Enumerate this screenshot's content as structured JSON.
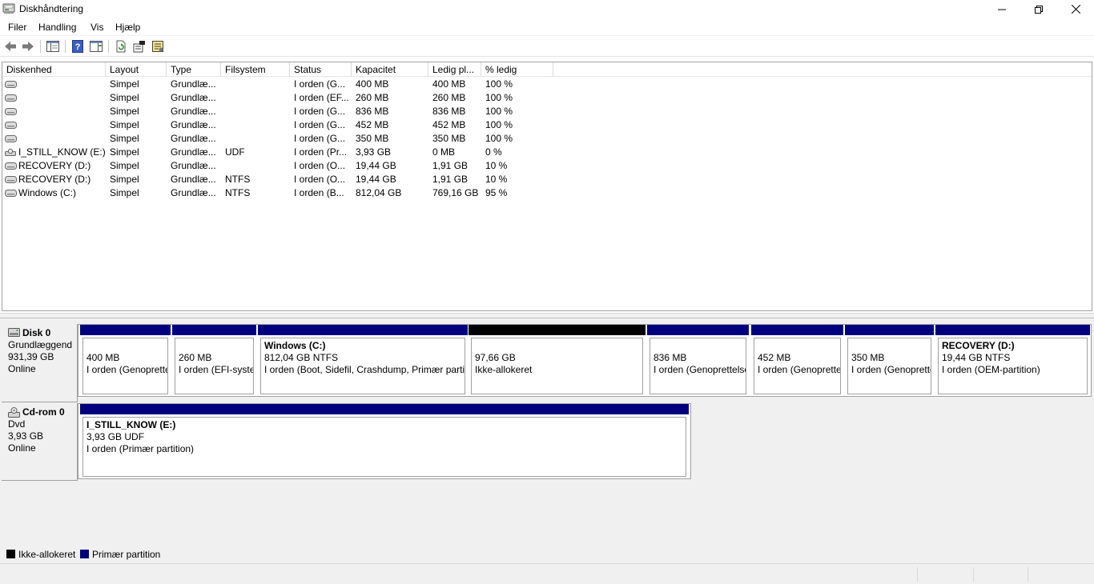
{
  "window": {
    "title": "Diskhåndtering"
  },
  "menu": [
    "Filer",
    "Handling",
    "Vis",
    "Hjælp"
  ],
  "toolbar_icons": [
    "back-arrow-icon",
    "forward-arrow-icon",
    "show-hide-console-tree-icon",
    "help-icon",
    "properties-pane-icon",
    "refresh-icon",
    "properties-icon",
    "settings-icon"
  ],
  "volume_list": {
    "columns": [
      "Diskenhed",
      "Layout",
      "Type",
      "Filsystem",
      "Status",
      "Kapacitet",
      "Ledig pl...",
      "% ledig"
    ],
    "rows": [
      [
        "",
        "Simpel",
        "Grundlæ...",
        "",
        "I orden (G...",
        "400 MB",
        "400 MB",
        "100 %"
      ],
      [
        "",
        "Simpel",
        "Grundlæ...",
        "",
        "I orden (EF...",
        "260 MB",
        "260 MB",
        "100 %"
      ],
      [
        "",
        "Simpel",
        "Grundlæ...",
        "",
        "I orden (G...",
        "836 MB",
        "836 MB",
        "100 %"
      ],
      [
        "",
        "Simpel",
        "Grundlæ...",
        "",
        "I orden (G...",
        "452 MB",
        "452 MB",
        "100 %"
      ],
      [
        "",
        "Simpel",
        "Grundlæ...",
        "",
        "I orden (G...",
        "350 MB",
        "350 MB",
        "100 %"
      ],
      [
        "I_STILL_KNOW (E:)",
        "Simpel",
        "Grundlæ...",
        "UDF",
        "I orden (Pr...",
        "3,93 GB",
        "0 MB",
        "0 %"
      ],
      [
        "RECOVERY (D:)",
        "Simpel",
        "Grundlæ...",
        "",
        "I orden (O...",
        "19,44 GB",
        "1,91 GB",
        "10 %"
      ],
      [
        "RECOVERY (D:)",
        "Simpel",
        "Grundlæ...",
        "NTFS",
        "I orden (O...",
        "19,44 GB",
        "1,91 GB",
        "10 %"
      ],
      [
        "Windows (C:)",
        "Simpel",
        "Grundlæ...",
        "NTFS",
        "I orden (B...",
        "812,04 GB",
        "769,16 GB",
        "95 %"
      ]
    ]
  },
  "disks": [
    {
      "name": "Disk 0",
      "kind": "Grundlæggend",
      "size": "931,39 GB",
      "state": "Online",
      "partitions": [
        {
          "title": "",
          "size": "400 MB",
          "status": "I orden (Genoprettelse)"
        },
        {
          "title": "",
          "size": "260 MB",
          "status": "I orden (EFI-systempartition)"
        },
        {
          "title": "Windows  (C:)",
          "size": "812,04 GB NTFS",
          "status": "I orden (Boot, Sidefil, Crashdump, Primær partition)"
        },
        {
          "title": "",
          "size": "97,66 GB",
          "status": "Ikke-allokeret"
        },
        {
          "title": "",
          "size": "836 MB",
          "status": "I orden (Genoprettelsespartition)"
        },
        {
          "title": "",
          "size": "452 MB",
          "status": "I orden (Genoprettelse)"
        },
        {
          "title": "",
          "size": "350 MB",
          "status": "I orden (Genoprettelse)"
        },
        {
          "title": "RECOVERY  (D:)",
          "size": "19,44 GB NTFS",
          "status": "I orden (OEM-partition)"
        }
      ]
    },
    {
      "name": "Cd-rom 0",
      "kind": "Dvd",
      "size": "3,93 GB",
      "state": "Online",
      "partitions": [
        {
          "title": "I_STILL_KNOW  (E:)",
          "size": "3,93 GB UDF",
          "status": "I orden (Primær partition)"
        }
      ]
    }
  ],
  "legend": [
    "Ikke-allokeret",
    "Primær partition"
  ],
  "colors": {
    "primary_partition": "#00007f",
    "unallocated": "#000000",
    "chrome": "#f0f0f0"
  }
}
